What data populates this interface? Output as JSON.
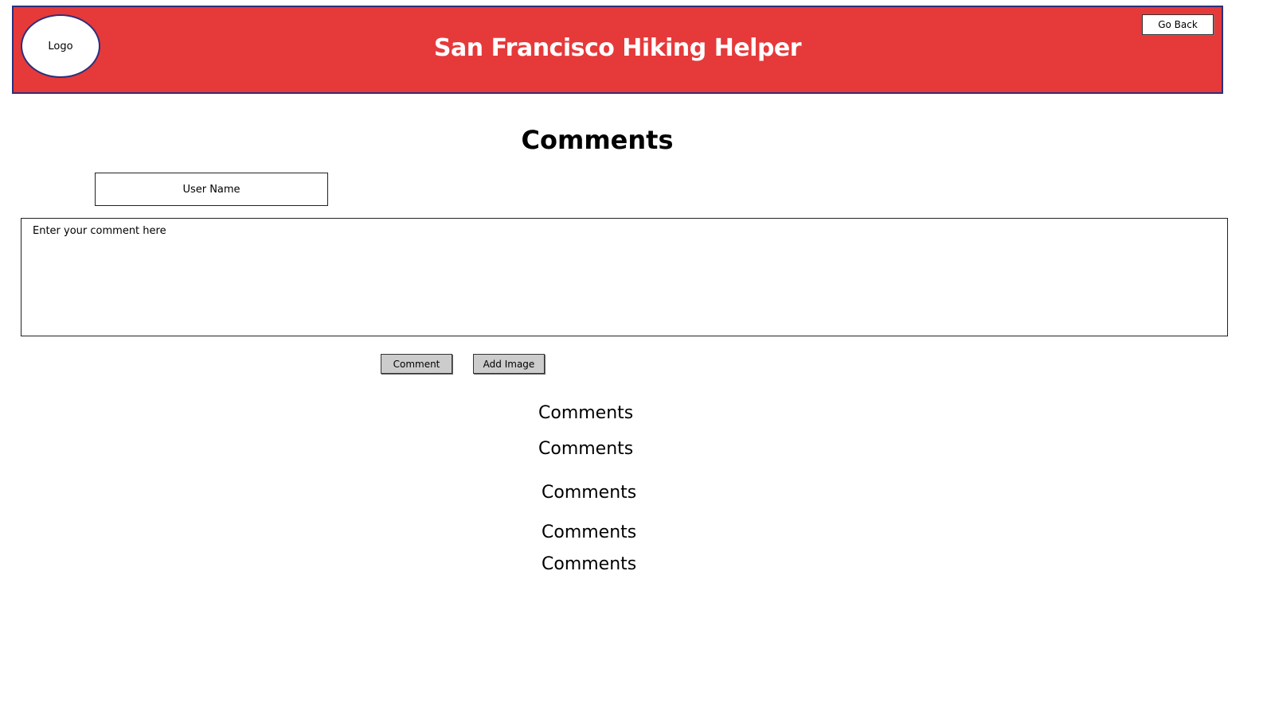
{
  "header": {
    "logo_text": "Logo",
    "title": "San Francisco Hiking Helper",
    "go_back_label": "Go Back"
  },
  "main": {
    "heading": "Comments",
    "username_placeholder": "User Name",
    "comment_placeholder": "Enter your comment here",
    "comment_button_label": "Comment",
    "add_image_button_label": "Add Image"
  },
  "comments": [
    {
      "text": "Comments"
    },
    {
      "text": "Comments"
    },
    {
      "text": "Comments"
    },
    {
      "text": "Comments"
    },
    {
      "text": "Comments"
    }
  ],
  "colors": {
    "header_bg": "#e6393a",
    "header_border": "#2b2f7a",
    "button_bg": "#cccccc"
  }
}
